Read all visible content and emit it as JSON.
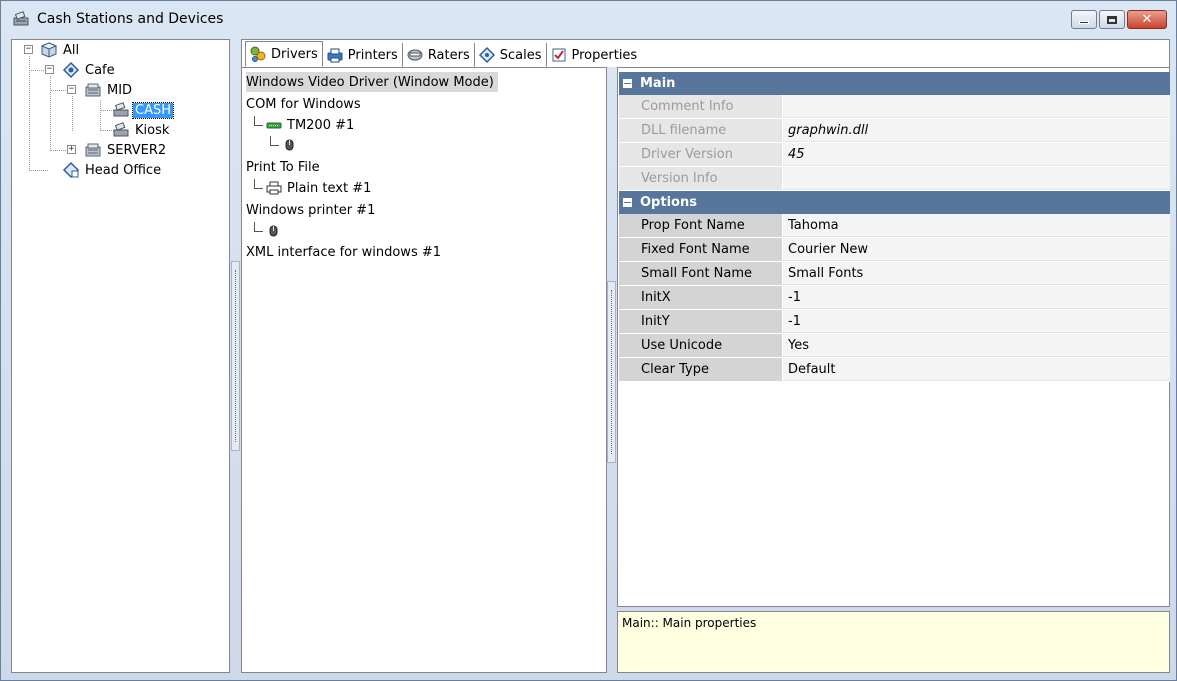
{
  "window": {
    "title": "Cash Stations and Devices"
  },
  "tree": {
    "nodes": [
      {
        "label": "All"
      },
      {
        "label": "Cafe"
      },
      {
        "label": "MID"
      },
      {
        "label": "CASH"
      },
      {
        "label": "Kiosk"
      },
      {
        "label": "SERVER2"
      },
      {
        "label": "Head Office"
      }
    ],
    "selected": "CASH"
  },
  "tabs": [
    {
      "label": "Drivers",
      "icon": "drivers-icon"
    },
    {
      "label": "Printers",
      "icon": "printer-icon"
    },
    {
      "label": "Raters",
      "icon": "rater-icon"
    },
    {
      "label": "Scales",
      "icon": "scale-icon"
    },
    {
      "label": "Properties",
      "icon": "properties-icon"
    }
  ],
  "drivers": {
    "items": [
      {
        "label": "Windows Video Driver (Window Mode)"
      },
      {
        "label": "COM for Windows"
      },
      {
        "label": "TM200 #1"
      },
      {
        "label": ""
      },
      {
        "label": "Print To File"
      },
      {
        "label": "Plain text #1"
      },
      {
        "label": "Windows printer #1"
      },
      {
        "label": ""
      },
      {
        "label": "XML interface for windows #1"
      }
    ]
  },
  "properties": {
    "main": {
      "title": "Main",
      "rows": [
        {
          "name": "Comment Info",
          "value": ""
        },
        {
          "name": "DLL filename",
          "value": "graphwin.dll"
        },
        {
          "name": "Driver Version",
          "value": "45"
        },
        {
          "name": "Version Info",
          "value": ""
        }
      ]
    },
    "options": {
      "title": "Options",
      "rows": [
        {
          "name": "Prop Font Name",
          "value": "Tahoma"
        },
        {
          "name": "Fixed Font Name",
          "value": "Courier New"
        },
        {
          "name": "Small Font Name",
          "value": "Small Fonts"
        },
        {
          "name": "InitX",
          "value": "-1"
        },
        {
          "name": "InitY",
          "value": "-1"
        },
        {
          "name": "Use Unicode",
          "value": "Yes"
        },
        {
          "name": "Clear Type",
          "value": "Default"
        }
      ]
    }
  },
  "description": {
    "text": "Main:: Main properties"
  },
  "colors": {
    "section_header": "#58759c",
    "selection": "#3399ff",
    "description_bg": "#ffffe1"
  }
}
